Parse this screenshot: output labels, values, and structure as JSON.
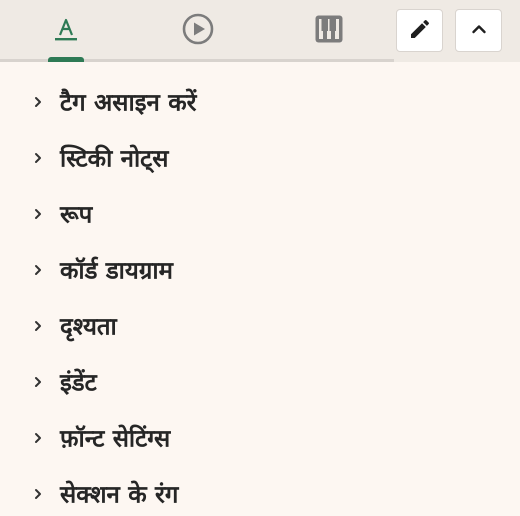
{
  "toolbar": {
    "tabs": [
      {
        "icon": "text-format-icon",
        "active": true
      },
      {
        "icon": "play-circle-icon",
        "active": false
      },
      {
        "icon": "piano-keys-icon",
        "active": false
      }
    ],
    "edit_button_icon": "pencil-icon",
    "collapse_button_icon": "chevron-up-icon",
    "accent_color": "#2e7a55"
  },
  "sections": [
    {
      "label": "टैग असाइन करें"
    },
    {
      "label": "स्टिकी नोट्स"
    },
    {
      "label": "रूप"
    },
    {
      "label": "कॉर्ड डायग्राम"
    },
    {
      "label": "दृश्यता"
    },
    {
      "label": "इंडेंट"
    },
    {
      "label": "फ़ॉन्ट सेटिंग्स"
    },
    {
      "label": "सेक्शन के रंग"
    }
  ]
}
